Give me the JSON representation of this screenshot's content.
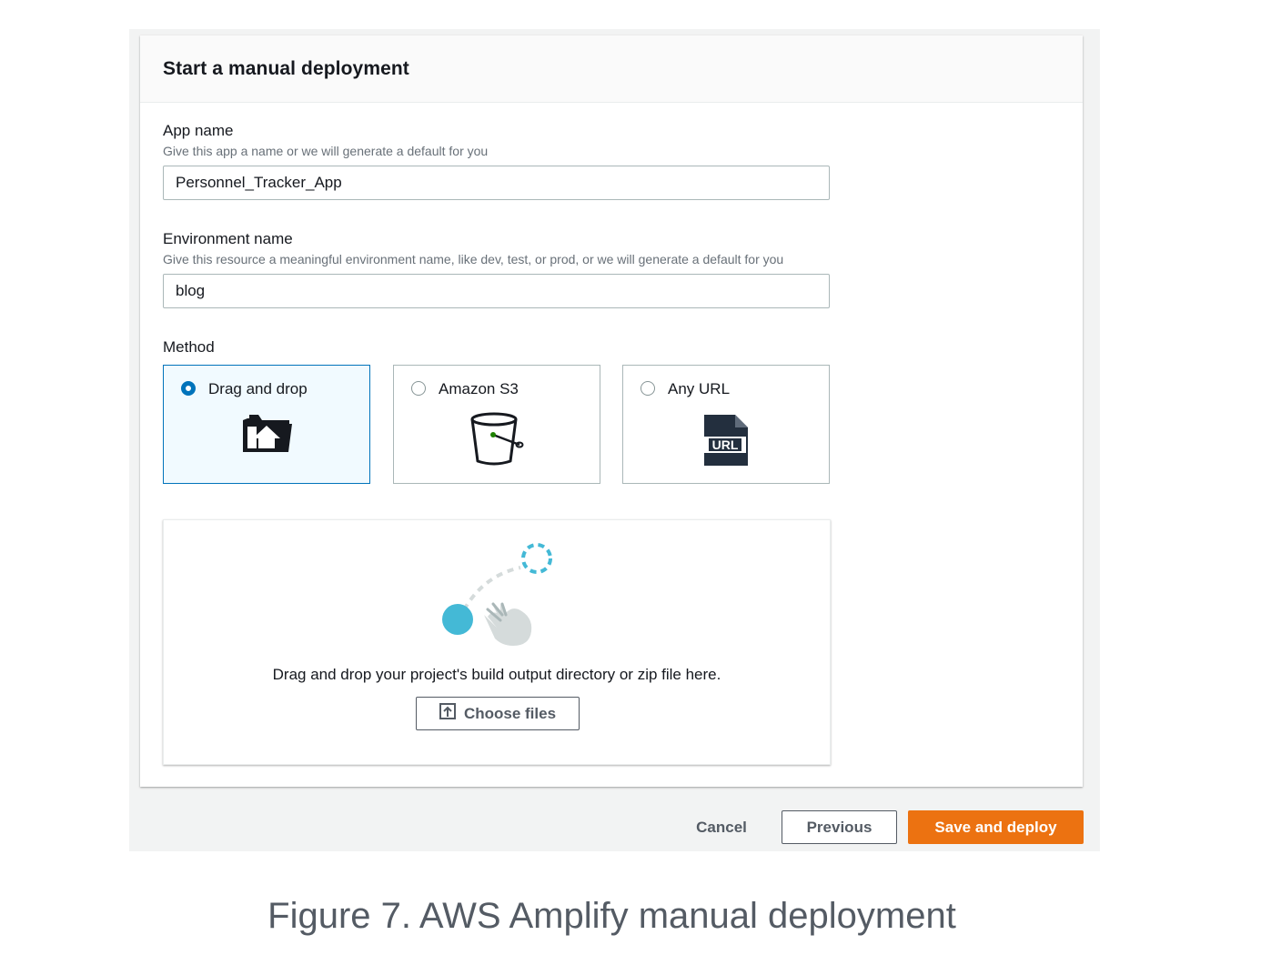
{
  "panel": {
    "title": "Start a manual deployment"
  },
  "app_name": {
    "label": "App name",
    "description": "Give this app a name or we will generate a default for you",
    "value": "Personnel_Tracker_App"
  },
  "environment_name": {
    "label": "Environment name",
    "description": "Give this resource a meaningful environment name, like dev, test, or prod, or we will generate a default for you",
    "value": "blog"
  },
  "method": {
    "label": "Method",
    "options": [
      {
        "label": "Drag and drop",
        "selected": true,
        "icon": "folder-upload-icon"
      },
      {
        "label": "Amazon S3",
        "selected": false,
        "icon": "s3-bucket-icon"
      },
      {
        "label": "Any URL",
        "selected": false,
        "icon": "url-file-icon"
      }
    ]
  },
  "dropzone": {
    "text": "Drag and drop your project's build output directory or zip file here.",
    "choose_files_label": "Choose files",
    "icon": "drag-gesture-illustration"
  },
  "actions": {
    "cancel": "Cancel",
    "previous": "Previous",
    "save_and_deploy": "Save and deploy"
  },
  "caption": "Figure 7. AWS Amplify manual deployment",
  "colors": {
    "primary_blue": "#0073bb",
    "accent_orange": "#ec7211",
    "text": "#16191f",
    "muted_text": "#687078",
    "border": "#aab7b8"
  }
}
